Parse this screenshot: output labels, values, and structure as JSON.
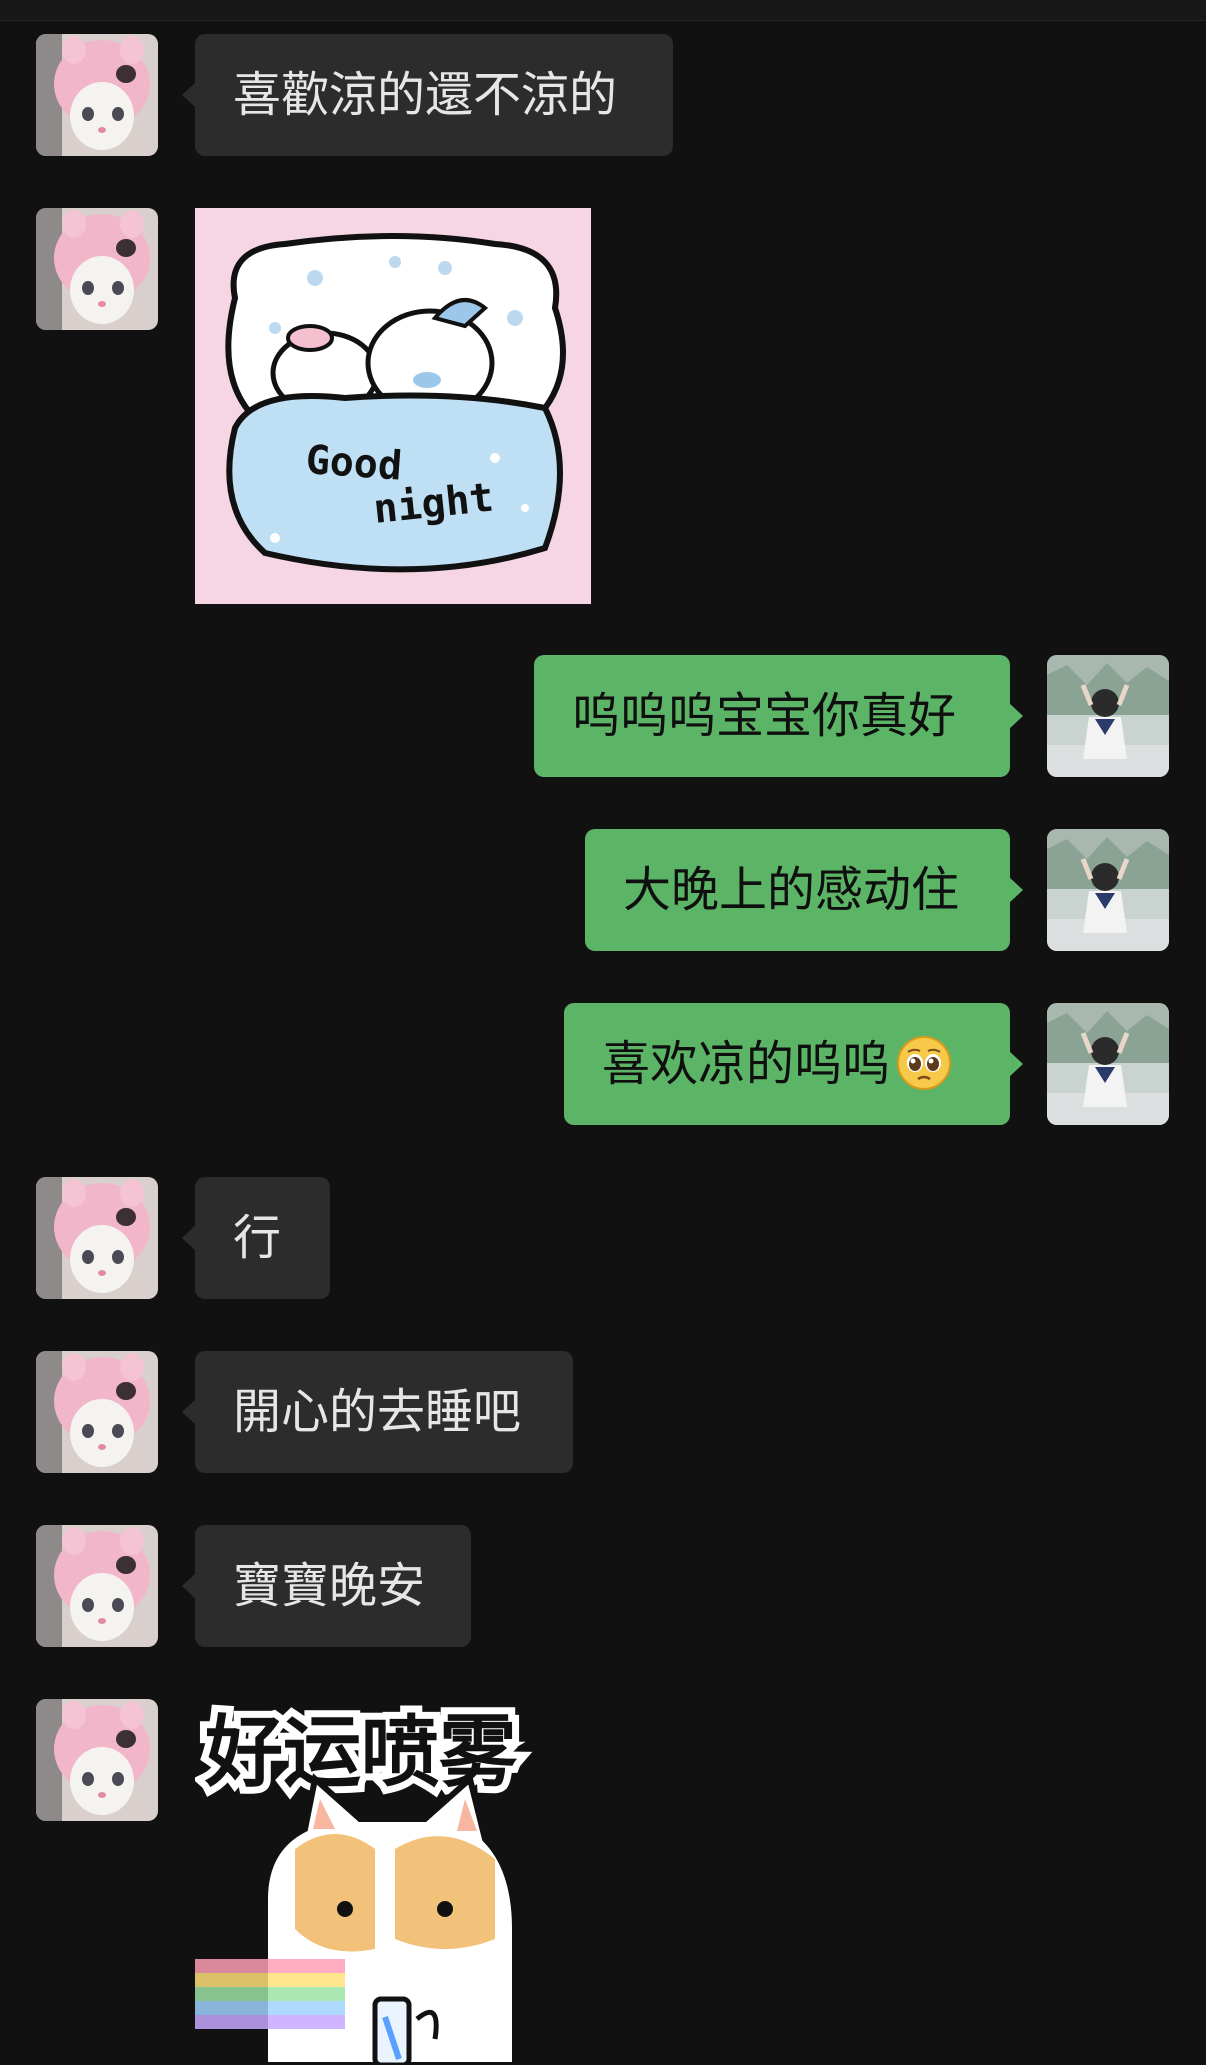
{
  "chat": {
    "messages": [
      {
        "id": "m1",
        "side": "in",
        "type": "text",
        "text": "喜歡涼的還不涼的"
      },
      {
        "id": "m2",
        "side": "in",
        "type": "sticker",
        "sticker_text": "Good night",
        "sticker_name": "goodnight-sticker"
      },
      {
        "id": "m3",
        "side": "out",
        "type": "text",
        "text": "呜呜呜宝宝你真好"
      },
      {
        "id": "m4",
        "side": "out",
        "type": "text",
        "text": "大晚上的感动住"
      },
      {
        "id": "m5",
        "side": "out",
        "type": "text",
        "text": "喜欢凉的呜呜",
        "emoji": "pleading-face-emoji"
      },
      {
        "id": "m6",
        "side": "in",
        "type": "text",
        "text": "行"
      },
      {
        "id": "m7",
        "side": "in",
        "type": "text",
        "text": "開心的去睡吧"
      },
      {
        "id": "m8",
        "side": "in",
        "type": "text",
        "text": "寶寶晚安"
      },
      {
        "id": "m9",
        "side": "in",
        "type": "sticker",
        "sticker_text": "好运喷雾",
        "sticker_name": "good-luck-spray-sticker"
      }
    ]
  },
  "avatars": {
    "contact": "cat-in-pink-hood-avatar",
    "self": "person-in-rain-avatar"
  },
  "colors": {
    "background": "#111111",
    "incoming_bubble": "#2c2c2c",
    "outgoing_bubble": "#5cb566",
    "incoming_text": "#e6e6e6",
    "outgoing_text": "#0f0f0f"
  }
}
